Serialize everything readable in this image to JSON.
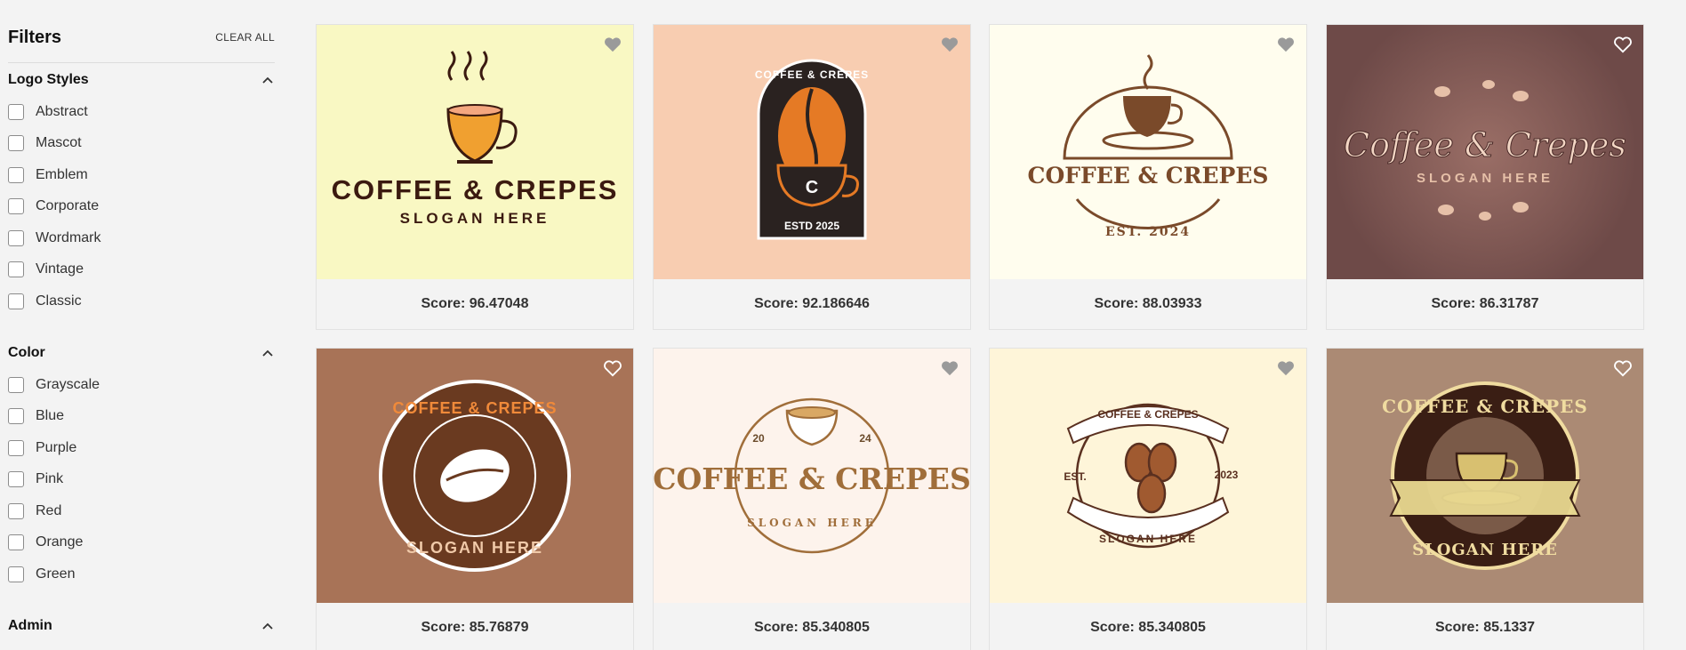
{
  "sidebar": {
    "title": "Filters",
    "clear_all": "CLEAR ALL",
    "sections": [
      {
        "title": "Logo Styles",
        "options": [
          "Abstract",
          "Mascot",
          "Emblem",
          "Corporate",
          "Wordmark",
          "Vintage",
          "Classic"
        ]
      },
      {
        "title": "Color",
        "options": [
          "Grayscale",
          "Blue",
          "Purple",
          "Pink",
          "Red",
          "Orange",
          "Green"
        ]
      },
      {
        "title": "Admin",
        "options": []
      }
    ]
  },
  "colors": {
    "page_bg": "#f3f3f3",
    "card_bgs": [
      "#f9f8c3",
      "#f8cdb1",
      "#fffdee",
      "#6e4a48",
      "#a87357",
      "#fdf3ec",
      "#fef5d9",
      "#ab8a74"
    ]
  },
  "cards": [
    {
      "score": "Score: 96.47048",
      "logo": {
        "line1": "COFFEE & CREPES",
        "line2": "SLOGAN HERE"
      }
    },
    {
      "score": "Score: 92.186646",
      "logo": {
        "line1": "COFFEE & CREPES",
        "line2": "ESTD 2025",
        "initial": "C"
      }
    },
    {
      "score": "Score: 88.03933",
      "logo": {
        "line1": "COFFEE & CREPES",
        "line2": "EST. 2024"
      }
    },
    {
      "score": "Score: 86.31787",
      "logo": {
        "line1": "Coffee & Crepes",
        "line2": "SLOGAN HERE"
      }
    },
    {
      "score": "Score: 85.76879",
      "logo": {
        "line1": "COFFEE & CREPES",
        "line2": "SLOGAN HERE"
      }
    },
    {
      "score": "Score: 85.340805",
      "logo": {
        "line1": "COFFEE & CREPES",
        "line2": "SLOGAN HERE",
        "year_left": "20",
        "year_right": "24"
      }
    },
    {
      "score": "Score: 85.340805",
      "logo": {
        "line1": "COFFEE & CREPES",
        "line2": "SLOGAN HERE",
        "year_left": "EST.",
        "year_right": "2023"
      }
    },
    {
      "score": "Score: 85.1337",
      "logo": {
        "line1": "COFFEE & CREPES",
        "line2": "SLOGAN HERE"
      }
    }
  ]
}
